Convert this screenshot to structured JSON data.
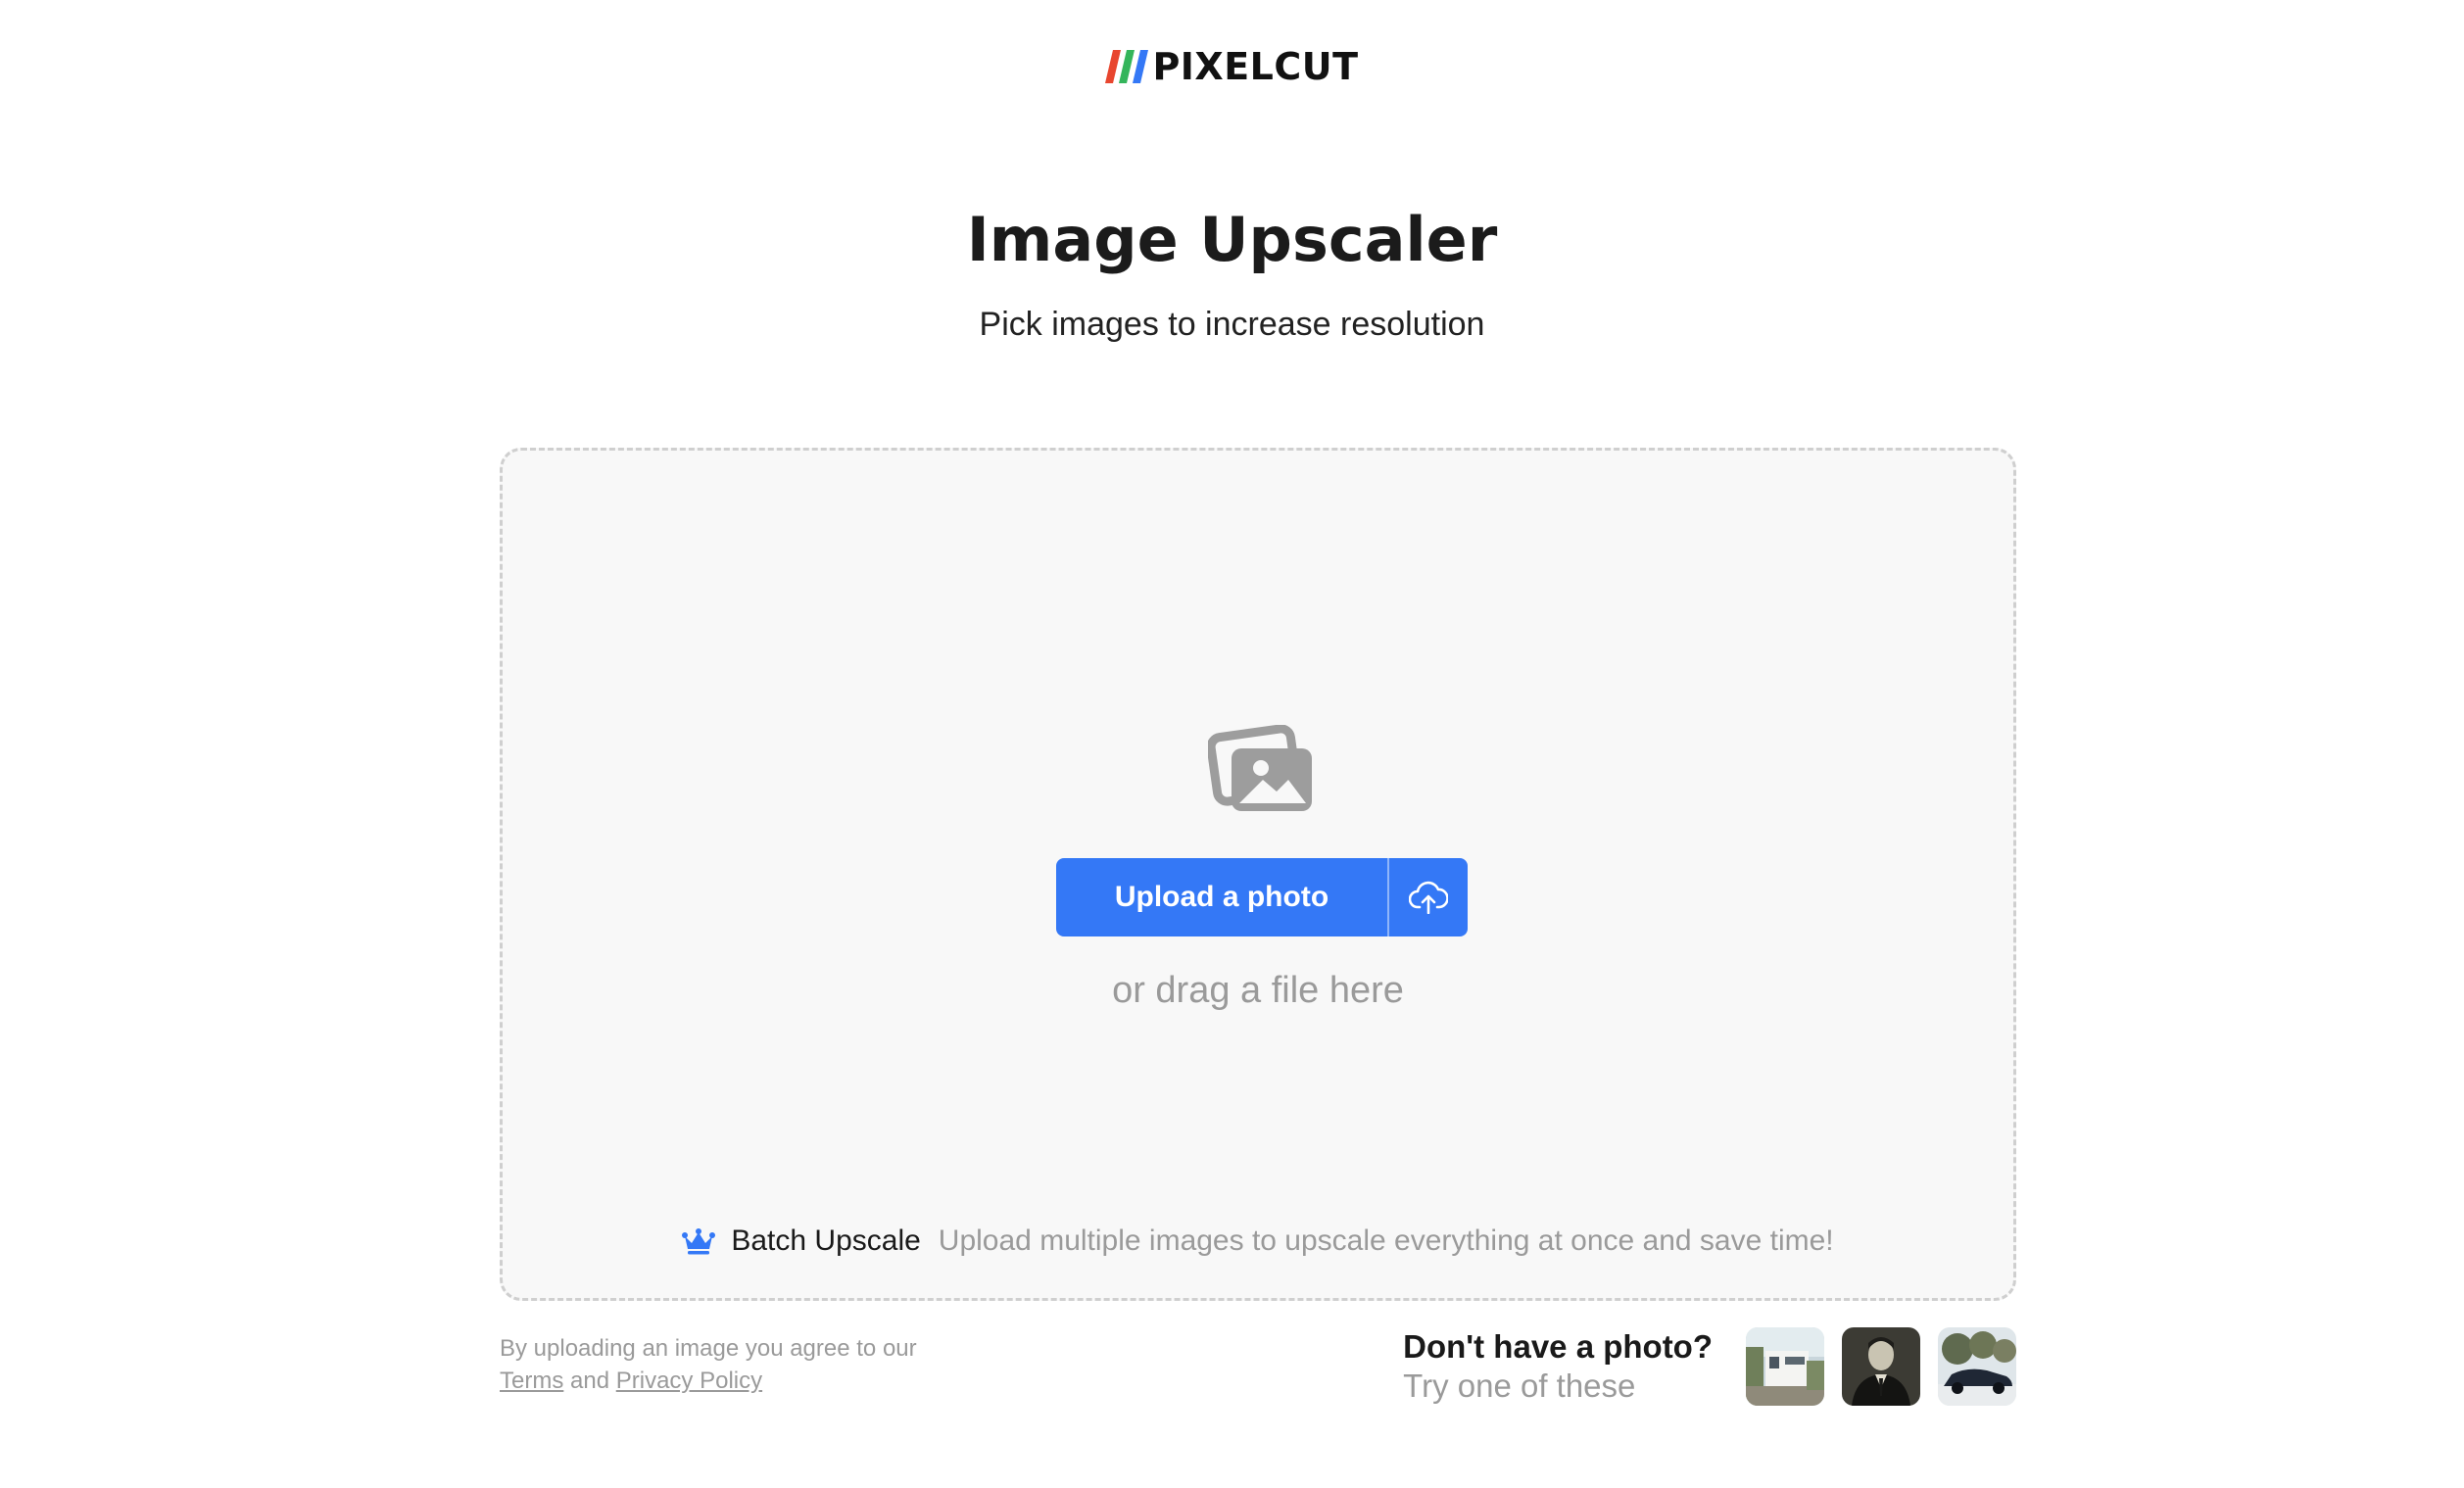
{
  "brand": {
    "name": "PIXELCUT",
    "stripe_colors": [
      "#e8462f",
      "#34b55b",
      "#3478f6"
    ]
  },
  "header": {
    "title": "Image Upscaler",
    "subtitle": "Pick images to increase resolution"
  },
  "dropzone": {
    "upload_label": "Upload a photo",
    "drag_text": "or drag a file here",
    "batch_title": "Batch Upscale",
    "batch_description": "Upload multiple images to upscale everything at once and save time!"
  },
  "legal": {
    "prefix": "By uploading an image you agree to our",
    "terms": "Terms",
    "and": "and",
    "privacy": "Privacy Policy"
  },
  "samples": {
    "title": "Don't have a photo?",
    "subtitle": "Try one of these",
    "items": [
      "sample-house-photo",
      "sample-portrait-photo",
      "sample-car-photo"
    ]
  },
  "colors": {
    "accent": "#3478f6",
    "dropzone_bg": "#f8f8f8",
    "muted_text": "#9a9a9a"
  }
}
